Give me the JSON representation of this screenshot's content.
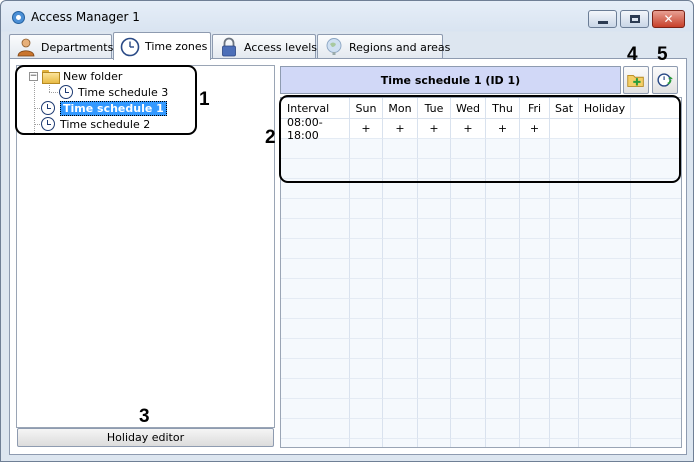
{
  "window": {
    "title": "Access Manager 1"
  },
  "tabs": [
    {
      "label": "Departments",
      "icon": "person-icon"
    },
    {
      "label": "Time zones",
      "icon": "clock-icon",
      "active": true
    },
    {
      "label": "Access levels",
      "icon": "lock-icon"
    },
    {
      "label": "Regions and areas",
      "icon": "globe-icon"
    }
  ],
  "tree": {
    "folder": {
      "label": "New folder",
      "expanded": true,
      "expander": "−"
    },
    "items": [
      {
        "label": "Time schedule 3",
        "indent": 1
      },
      {
        "label": "Time schedule 1",
        "indent": 0,
        "selected": true
      },
      {
        "label": "Time schedule 2",
        "indent": 0
      }
    ]
  },
  "holiday_button": {
    "label": "Holiday editor"
  },
  "schedule": {
    "header": "Time schedule 1 (ID 1)",
    "columns": [
      "Interval",
      "Sun",
      "Mon",
      "Tue",
      "Wed",
      "Thu",
      "Fri",
      "Sat",
      "Holiday"
    ],
    "rows": [
      [
        "08:00-18:00",
        "+",
        "+",
        "+",
        "+",
        "+",
        "+",
        "",
        ""
      ]
    ]
  },
  "toolbar": {
    "add_button_icon": "folder-add-icon",
    "refresh_button_icon": "clock-refresh-icon"
  },
  "annotations": [
    "1",
    "2",
    "3",
    "4",
    "5"
  ],
  "colors": {
    "selection": "#3399ff",
    "header_band": "#d1d8f7",
    "close_button": "#c7402a"
  }
}
